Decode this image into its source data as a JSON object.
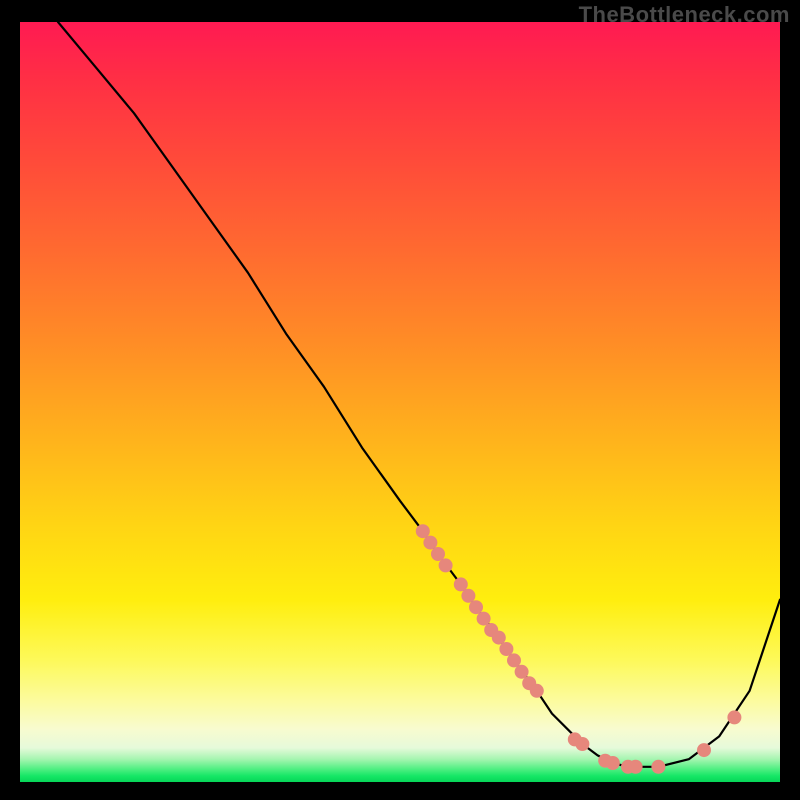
{
  "watermark": "TheBottleneck.com",
  "chart_data": {
    "type": "line",
    "title": "",
    "xlabel": "",
    "ylabel": "",
    "xlim": [
      0,
      100
    ],
    "ylim": [
      0,
      100
    ],
    "curve": {
      "x": [
        5,
        10,
        15,
        20,
        25,
        30,
        35,
        40,
        45,
        50,
        53,
        55,
        58,
        60,
        63,
        65,
        68,
        70,
        72,
        74,
        76,
        78,
        80,
        84,
        88,
        92,
        96,
        100
      ],
      "y": [
        100,
        94,
        88,
        81,
        74,
        67,
        59,
        52,
        44,
        37,
        33,
        30,
        26,
        23,
        19,
        16,
        12,
        9,
        7,
        5,
        3.5,
        2.5,
        2,
        2,
        3,
        6,
        12,
        24
      ]
    },
    "points": [
      {
        "x": 53,
        "y": 33
      },
      {
        "x": 54,
        "y": 31.5
      },
      {
        "x": 55,
        "y": 30
      },
      {
        "x": 56,
        "y": 28.5
      },
      {
        "x": 58,
        "y": 26
      },
      {
        "x": 59,
        "y": 24.5
      },
      {
        "x": 60,
        "y": 23
      },
      {
        "x": 61,
        "y": 21.5
      },
      {
        "x": 62,
        "y": 20
      },
      {
        "x": 63,
        "y": 19
      },
      {
        "x": 64,
        "y": 17.5
      },
      {
        "x": 65,
        "y": 16
      },
      {
        "x": 66,
        "y": 14.5
      },
      {
        "x": 67,
        "y": 13
      },
      {
        "x": 68,
        "y": 12
      },
      {
        "x": 73,
        "y": 5.6
      },
      {
        "x": 74,
        "y": 5
      },
      {
        "x": 77,
        "y": 2.8
      },
      {
        "x": 78,
        "y": 2.5
      },
      {
        "x": 80,
        "y": 2
      },
      {
        "x": 81,
        "y": 2
      },
      {
        "x": 84,
        "y": 2
      },
      {
        "x": 90,
        "y": 4.2
      },
      {
        "x": 94,
        "y": 8.5
      }
    ],
    "gradient_description": "vertical heat gradient from red (top) through orange and yellow to green (bottom)"
  }
}
